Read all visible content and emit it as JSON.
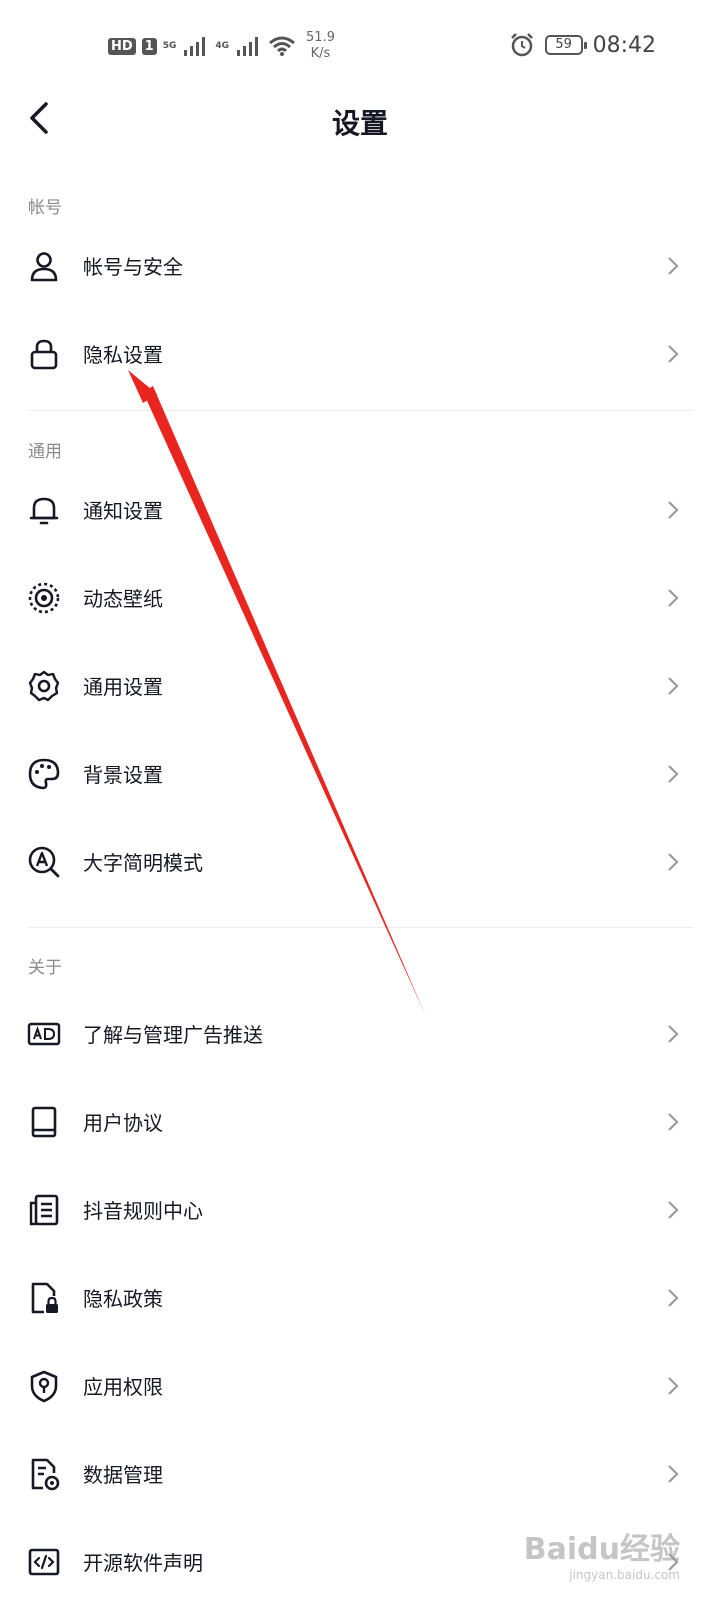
{
  "status_bar": {
    "hd": "HD",
    "sim": "1",
    "net1": "5G",
    "net2": "4G",
    "speed_value": "51.9",
    "speed_unit": "K/s",
    "battery": "59",
    "time": "08:42"
  },
  "header": {
    "title": "设置"
  },
  "sections": {
    "account": {
      "label": "帐号"
    },
    "general": {
      "label": "通用"
    },
    "about": {
      "label": "关于"
    }
  },
  "rows": [
    {
      "label": "帐号与安全",
      "icon": "user-icon"
    },
    {
      "label": "隐私设置",
      "icon": "lock-icon"
    },
    {
      "label": "通知设置",
      "icon": "bell-icon"
    },
    {
      "label": "动态壁纸",
      "icon": "wallpaper-icon"
    },
    {
      "label": "通用设置",
      "icon": "gear-icon"
    },
    {
      "label": "背景设置",
      "icon": "palette-icon"
    },
    {
      "label": "大字简明模式",
      "icon": "large-font-icon"
    },
    {
      "label": "了解与管理广告推送",
      "icon": "ad-icon"
    },
    {
      "label": "用户协议",
      "icon": "book-icon"
    },
    {
      "label": "抖音规则中心",
      "icon": "document-list-icon"
    },
    {
      "label": "隐私政策",
      "icon": "file-lock-icon"
    },
    {
      "label": "应用权限",
      "icon": "shield-icon"
    },
    {
      "label": "数据管理",
      "icon": "file-gear-icon"
    },
    {
      "label": "开源软件声明",
      "icon": "code-icon"
    }
  ],
  "watermark": {
    "main": "Baidu经验",
    "sub": "jingyan.baidu.com"
  },
  "colors": {
    "annotation_arrow": "#e8261f",
    "text": "#161823",
    "section_label": "#8a8b91"
  }
}
